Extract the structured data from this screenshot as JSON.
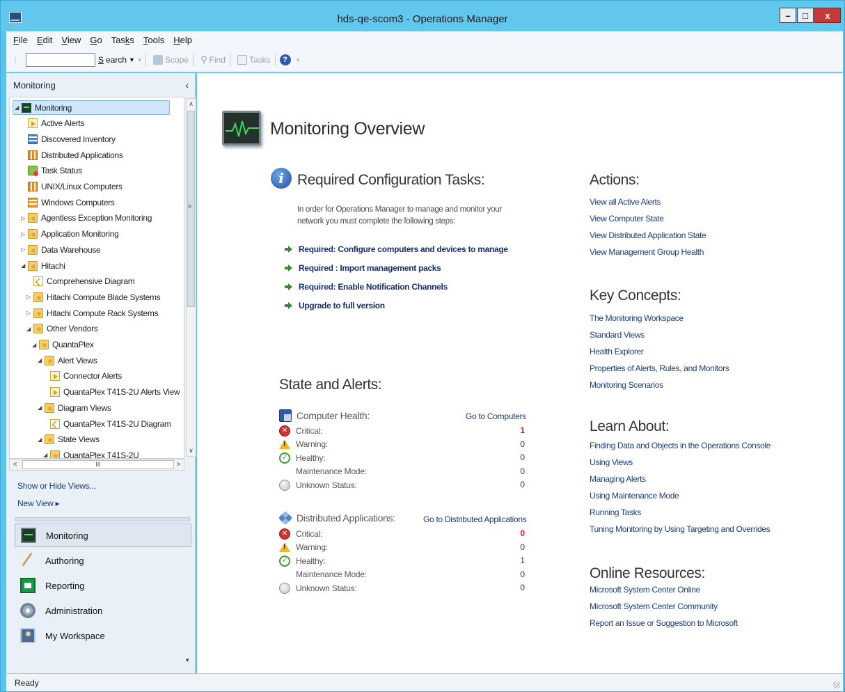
{
  "window": {
    "title": "hds-qe-scom3 - Operations Manager",
    "minimize_label": "–",
    "maximize_label": "□",
    "close_label": "x"
  },
  "menu": [
    {
      "key": "F",
      "rest": "ile"
    },
    {
      "key": "E",
      "rest": "dit"
    },
    {
      "key": "V",
      "rest": "iew"
    },
    {
      "key": "G",
      "rest": "o"
    },
    {
      "pre": "Tas",
      "key": "k",
      "rest": "s"
    },
    {
      "key": "T",
      "rest": "ools"
    },
    {
      "key": "H",
      "rest": "elp"
    }
  ],
  "toolbar": {
    "search_value": "",
    "search_pre": "",
    "search_key": "S",
    "search_rest": "earch",
    "scope_label": "Scope",
    "find_label": "Find",
    "tasks_label": "Tasks",
    "help_glyph": "?"
  },
  "nav": {
    "header": "Monitoring",
    "collapse_glyph": "‹",
    "tree": [
      {
        "label": "Monitoring",
        "level": 0,
        "expander": "◢",
        "icon": "monitor",
        "selected": true
      },
      {
        "label": "Active Alerts",
        "level": 1,
        "expander": "",
        "icon": "alert"
      },
      {
        "label": "Discovered Inventory",
        "level": 1,
        "expander": "",
        "icon": "inventory"
      },
      {
        "label": "Distributed Applications",
        "level": 1,
        "expander": "",
        "icon": "grid"
      },
      {
        "label": "Task Status",
        "level": 1,
        "expander": "",
        "icon": "task"
      },
      {
        "label": "UNIX/Linux Computers",
        "level": 1,
        "expander": "",
        "icon": "grid"
      },
      {
        "label": "Windows Computers",
        "level": 1,
        "expander": "",
        "icon": "grid2"
      },
      {
        "label": "Agentless Exception Monitoring",
        "level": 1,
        "expander": "▷",
        "icon": "folder"
      },
      {
        "label": "Application Monitoring",
        "level": 1,
        "expander": "▷",
        "icon": "folder"
      },
      {
        "label": "Data Warehouse",
        "level": 1,
        "expander": "▷",
        "icon": "folder"
      },
      {
        "label": "Hitachi",
        "level": 1,
        "expander": "◢",
        "icon": "folder"
      },
      {
        "label": "Comprehensive Diagram",
        "level": 2,
        "expander": "",
        "icon": "diagram"
      },
      {
        "label": "Hitachi Compute Blade Systems",
        "level": 2,
        "expander": "▷",
        "icon": "folder"
      },
      {
        "label": "Hitachi Compute Rack Systems",
        "level": 2,
        "expander": "▷",
        "icon": "folder"
      },
      {
        "label": "Other Vendors",
        "level": 2,
        "expander": "◢",
        "icon": "folder"
      },
      {
        "label": "QuantaPlex",
        "level": 3,
        "expander": "◢",
        "icon": "folder"
      },
      {
        "label": "Alert Views",
        "level": 4,
        "expander": "◢",
        "icon": "folder"
      },
      {
        "label": "Connector Alerts",
        "level": 5,
        "expander": "",
        "icon": "alert"
      },
      {
        "label": "QuantaPlex T41S-2U Alerts View",
        "level": 5,
        "expander": "",
        "icon": "alert"
      },
      {
        "label": "Diagram Views",
        "level": 4,
        "expander": "◢",
        "icon": "folder"
      },
      {
        "label": "QuantaPlex T41S-2U Diagram",
        "level": 5,
        "expander": "",
        "icon": "diagram"
      },
      {
        "label": "State Views",
        "level": 4,
        "expander": "◢",
        "icon": "folder"
      },
      {
        "label": "QuantaPlex T41S-2U",
        "level": 5,
        "expander": "◢",
        "icon": "folder"
      }
    ],
    "scroll_up": "∧",
    "scroll_down": "∨",
    "scroll_left": "<",
    "scroll_right": ">",
    "scroll_grip": "≡",
    "hscroll_grip": "III",
    "show_hide_views": "Show or Hide Views...",
    "new_view": "New View ▸",
    "workspaces": [
      {
        "label": "Monitoring",
        "icon": "monitor",
        "active": true
      },
      {
        "label": "Authoring",
        "icon": "authoring",
        "active": false
      },
      {
        "label": "Reporting",
        "icon": "reporting",
        "active": false
      },
      {
        "label": "Administration",
        "icon": "admin",
        "active": false
      },
      {
        "label": "My Workspace",
        "icon": "workspace",
        "active": false
      }
    ],
    "more_glyph": "▾"
  },
  "overview": {
    "title": "Monitoring Overview",
    "required": {
      "title": "Required Configuration Tasks:",
      "description": "In order for Operations Manager to manage and monitor your network you must complete the following steps:",
      "links": [
        "Required: Configure computers and devices to manage",
        "Required : Import management packs",
        "Required: Enable Notification Channels",
        "Upgrade to full version"
      ]
    },
    "state_title": "State and Alerts:",
    "computer_health": {
      "title": "Computer Health:",
      "goto": "Go to Computers",
      "rows": [
        {
          "label": "Critical:",
          "count": "1",
          "status": "critical"
        },
        {
          "label": "Warning:",
          "count": "0",
          "status": "warning"
        },
        {
          "label": "Healthy:",
          "count": "0",
          "status": "healthy"
        },
        {
          "label": "Maintenance Mode:",
          "count": "0",
          "status": "maintenance"
        },
        {
          "label": "Unknown Status:",
          "count": "0",
          "status": "unknown"
        }
      ]
    },
    "distributed_apps": {
      "title": "Distributed Applications:",
      "goto": "Go to Distributed Applications",
      "rows": [
        {
          "label": "Critical:",
          "count": "0",
          "status": "critical"
        },
        {
          "label": "Warning:",
          "count": "0",
          "status": "warning"
        },
        {
          "label": "Healthy:",
          "count": "1",
          "status": "healthy"
        },
        {
          "label": "Maintenance Mode:",
          "count": "0",
          "status": "maintenance"
        },
        {
          "label": "Unknown Status:",
          "count": "0",
          "status": "unknown"
        }
      ]
    },
    "actions": {
      "title": "Actions:",
      "links": [
        "View all Active Alerts",
        "View Computer State",
        "View Distributed Application State",
        "View Management Group Health"
      ]
    },
    "key_concepts": {
      "title": "Key Concepts:",
      "links": [
        "The Monitoring Workspace",
        "Standard Views",
        "Health Explorer",
        "Properties of Alerts, Rules, and Monitors",
        "Monitoring Scenarios"
      ]
    },
    "learn_about": {
      "title": "Learn About:",
      "links": [
        "Finding Data and Objects in the Operations Console",
        "Using Views",
        "Managing Alerts",
        "Using Maintenance Mode",
        "Running Tasks",
        "Tuning Monitoring by Using Targeting and Overrides"
      ]
    },
    "online_resources": {
      "title": "Online Resources:",
      "links": [
        "Microsoft System Center Online",
        "Microsoft System Center Community",
        "Report an Issue or Suggestion to Microsoft"
      ]
    }
  },
  "status": {
    "text": "Ready"
  },
  "colors": {
    "accent": "#5cc4ea",
    "critical_count": "#e02020",
    "link": "#1a3c78"
  }
}
